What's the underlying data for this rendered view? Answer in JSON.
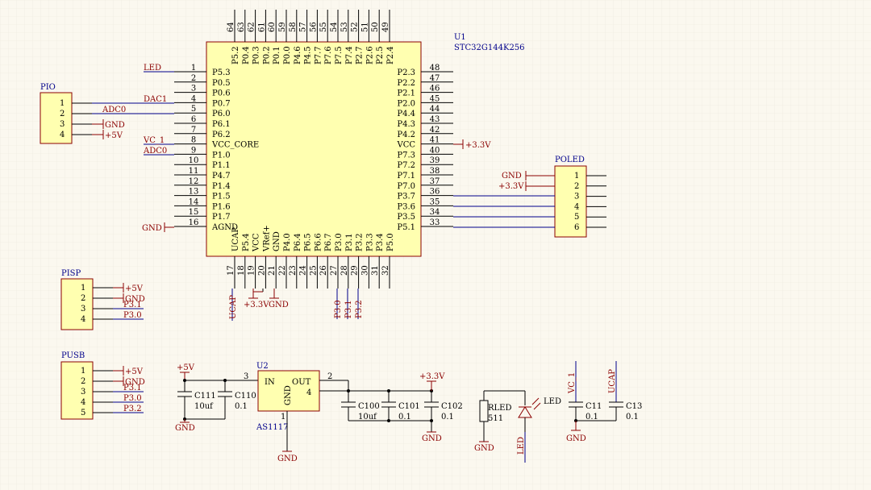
{
  "u1": {
    "ref": "U1",
    "part": "STC32G144K256",
    "left_pins": [
      {
        "num": "1",
        "name": "P5.3"
      },
      {
        "num": "2",
        "name": "P0.5"
      },
      {
        "num": "3",
        "name": "P0.6"
      },
      {
        "num": "4",
        "name": "P0.7"
      },
      {
        "num": "5",
        "name": "P6.0"
      },
      {
        "num": "6",
        "name": "P6.1"
      },
      {
        "num": "7",
        "name": "P6.2"
      },
      {
        "num": "8",
        "name": "VCC_CORE"
      },
      {
        "num": "9",
        "name": "P1.0"
      },
      {
        "num": "10",
        "name": "P1.1"
      },
      {
        "num": "11",
        "name": "P4.7"
      },
      {
        "num": "12",
        "name": "P1.4"
      },
      {
        "num": "13",
        "name": "P1.5"
      },
      {
        "num": "14",
        "name": "P1.6"
      },
      {
        "num": "15",
        "name": "P1.7"
      },
      {
        "num": "16",
        "name": "AGND"
      }
    ],
    "right_pins": [
      {
        "num": "48",
        "name": "P2.3"
      },
      {
        "num": "47",
        "name": "P2.2"
      },
      {
        "num": "46",
        "name": "P2.1"
      },
      {
        "num": "45",
        "name": "P2.0"
      },
      {
        "num": "44",
        "name": "P4.4"
      },
      {
        "num": "43",
        "name": "P4.3"
      },
      {
        "num": "42",
        "name": "P4.2"
      },
      {
        "num": "41",
        "name": "VCC"
      },
      {
        "num": "40",
        "name": "P7.3"
      },
      {
        "num": "39",
        "name": "P7.2"
      },
      {
        "num": "38",
        "name": "P7.1"
      },
      {
        "num": "37",
        "name": "P7.0"
      },
      {
        "num": "36",
        "name": "P3.7"
      },
      {
        "num": "35",
        "name": "P3.6"
      },
      {
        "num": "34",
        "name": "P3.5"
      },
      {
        "num": "33",
        "name": "P5.1"
      }
    ],
    "top_pins": [
      {
        "num": "64",
        "name": "P5.2"
      },
      {
        "num": "63",
        "name": "P0.4"
      },
      {
        "num": "62",
        "name": "P0.3"
      },
      {
        "num": "61",
        "name": "P0.2"
      },
      {
        "num": "60",
        "name": "P0.1"
      },
      {
        "num": "59",
        "name": "P0.0"
      },
      {
        "num": "58",
        "name": "P4.6"
      },
      {
        "num": "57",
        "name": "P4.5"
      },
      {
        "num": "56",
        "name": "P7.7"
      },
      {
        "num": "55",
        "name": "P7.6"
      },
      {
        "num": "54",
        "name": "P7.5"
      },
      {
        "num": "53",
        "name": "P7.4"
      },
      {
        "num": "52",
        "name": "P2.7"
      },
      {
        "num": "51",
        "name": "P2.6"
      },
      {
        "num": "50",
        "name": "P2.5"
      },
      {
        "num": "49",
        "name": "P2.4"
      }
    ],
    "bottom_pins": [
      {
        "num": "17",
        "name": "UCAP"
      },
      {
        "num": "18",
        "name": "P5.4"
      },
      {
        "num": "19",
        "name": "VCC"
      },
      {
        "num": "20",
        "name": "VRef+"
      },
      {
        "num": "21",
        "name": "GND"
      },
      {
        "num": "22",
        "name": "P4.0"
      },
      {
        "num": "23",
        "name": "P6.4"
      },
      {
        "num": "24",
        "name": "P6.5"
      },
      {
        "num": "25",
        "name": "P6.6"
      },
      {
        "num": "26",
        "name": "P6.7"
      },
      {
        "num": "27",
        "name": "P3.0"
      },
      {
        "num": "28",
        "name": "P3.1"
      },
      {
        "num": "29",
        "name": "P3.2"
      },
      {
        "num": "30",
        "name": "P3.3"
      },
      {
        "num": "31",
        "name": "P3.4"
      },
      {
        "num": "32",
        "name": "P5.0"
      }
    ]
  },
  "u1_nets": {
    "led": "LED",
    "dac1": "DAC1",
    "vc1": "VC_1",
    "adc0": "ADC0",
    "gnd": "GND",
    "vcc_right": "+3.3V",
    "ucap": "UCAP",
    "v33": "+3.3V",
    "gnd_bottom": "GND",
    "p30": "P3.0",
    "p31": "P3.1",
    "p32": "P3.2"
  },
  "pio": {
    "ref": "PIO",
    "pins": [
      "1",
      "2",
      "3",
      "4"
    ],
    "adc0": "ADC0",
    "gnd": "GND",
    "p5v": "+5V"
  },
  "poled": {
    "ref": "POLED",
    "pins": [
      "1",
      "2",
      "3",
      "4",
      "5",
      "6"
    ],
    "gnd": "GND",
    "v33": "+3.3V"
  },
  "pisp": {
    "ref": "PISP",
    "pins": [
      "1",
      "2",
      "3",
      "4"
    ],
    "p5v": "+5V",
    "gnd": "GND",
    "p31": "P3.1",
    "p30": "P3.0"
  },
  "pusb": {
    "ref": "PUSB",
    "pins": [
      "1",
      "2",
      "3",
      "4",
      "5"
    ],
    "p5v": "+5V",
    "gnd": "GND",
    "p31": "P3.1",
    "p30": "P3.0",
    "p32": "P3.2"
  },
  "regulator": {
    "ref": "U2",
    "part": "AS1117",
    "in": "IN",
    "out": "OUT",
    "gndpin": "GND",
    "pin_in": "3",
    "pin_out": "2",
    "pin_out2": "4",
    "pin_gnd": "1",
    "gnd": "GND",
    "p5v": "+5V",
    "v33": "+3.3V"
  },
  "caps": {
    "c111": "C111",
    "c111_val": "10uf",
    "c110": "C110",
    "c110_val": "0.1",
    "c100": "C100",
    "c100_val": "10uf",
    "c101": "C101",
    "c101_val": "0.1",
    "c102": "C102",
    "c102_val": "0.1",
    "gnd_in": "GND",
    "gnd_out": "GND",
    "c11": "C11",
    "c11_val": "0.1",
    "c13": "C13",
    "c13_val": "0.1",
    "vc1": "VC_1",
    "ucap": "UCAP",
    "gnd_c": "GND"
  },
  "led_circuit": {
    "rled": "RLED",
    "rled_val": "511",
    "led": "LED",
    "net": "LED",
    "gnd": "GND"
  },
  "colors": {
    "wire": "#00008b",
    "power": "#8b0000",
    "body": "#ffffb0",
    "grid": "#e6e2d8"
  }
}
